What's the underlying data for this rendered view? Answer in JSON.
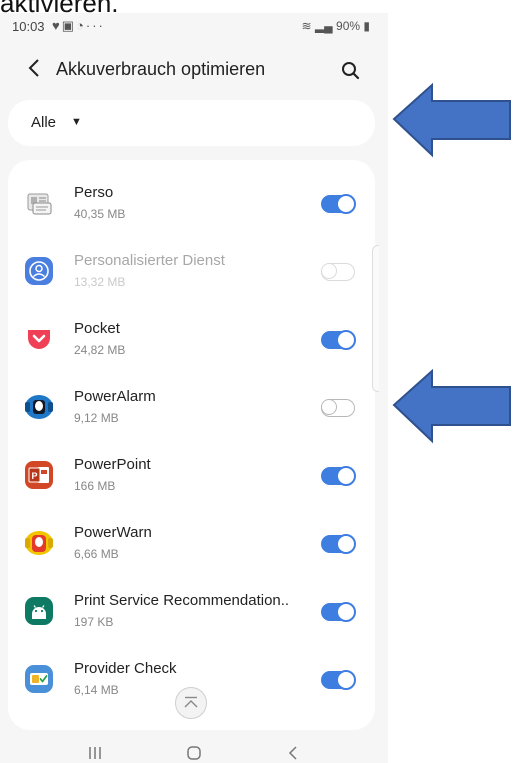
{
  "caption": {
    "partial_text": "aktivieren."
  },
  "status_bar": {
    "time": "10:03",
    "battery": "90%"
  },
  "header": {
    "title": "Akkuverbrauch optimieren"
  },
  "filter": {
    "label": "Alle"
  },
  "apps": [
    {
      "name": "Perso",
      "size": "40,35 MB",
      "toggle": "on",
      "enabled": true,
      "icon": "id-card-icon"
    },
    {
      "name": "Personalisierter Dienst",
      "size": "13,32 MB",
      "toggle": "off",
      "enabled": false,
      "icon": "person-sync-icon"
    },
    {
      "name": "Pocket",
      "size": "24,82 MB",
      "toggle": "on",
      "enabled": true,
      "icon": "pocket-icon"
    },
    {
      "name": "PowerAlarm",
      "size": "9,12 MB",
      "toggle": "off",
      "enabled": true,
      "icon": "alarm-icon"
    },
    {
      "name": "PowerPoint",
      "size": "166 MB",
      "toggle": "on",
      "enabled": true,
      "icon": "powerpoint-icon"
    },
    {
      "name": "PowerWarn",
      "size": "6,66 MB",
      "toggle": "on",
      "enabled": true,
      "icon": "warning-light-icon"
    },
    {
      "name": "Print Service Recommendation..",
      "size": "197 KB",
      "toggle": "on",
      "enabled": true,
      "icon": "android-icon"
    },
    {
      "name": "Provider Check",
      "size": "6,14 MB",
      "toggle": "on",
      "enabled": true,
      "icon": "sim-check-icon"
    }
  ],
  "colors": {
    "accent": "#3e7ee0",
    "arrow": "#4472c4",
    "background": "#f6f6f6",
    "card": "#ffffff"
  }
}
